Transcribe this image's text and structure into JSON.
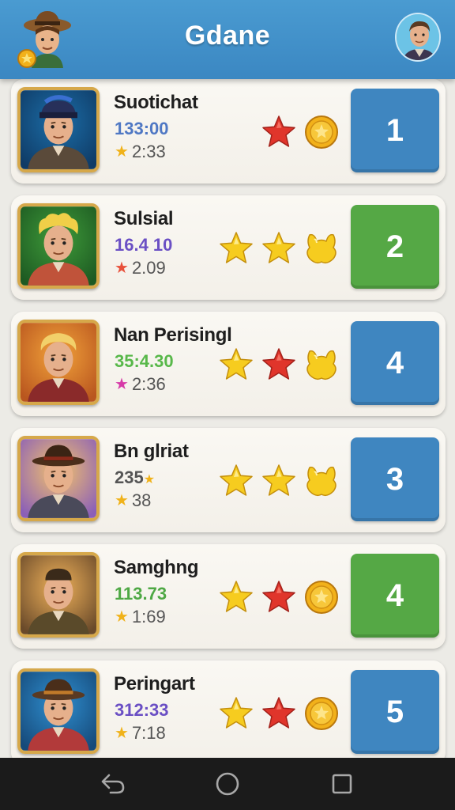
{
  "header": {
    "title": "Gdane"
  },
  "colors": {
    "header": "#3b87c2",
    "rank_blue": "#3f86c0",
    "rank_green": "#55a845",
    "star_red": "#e0352b",
    "star_yellow": "#f6cc1f",
    "coin": "#f2b11a"
  },
  "players": [
    {
      "name": "Suotichat",
      "score": "133:00",
      "score_color": "#4f78c4",
      "time": "2:33",
      "time_star_color": "#f0b21a",
      "badges": [
        "red-star-icon",
        "coin-icon"
      ],
      "rank": "1",
      "rank_color": "#3f86c0",
      "portrait_bg": [
        "#1c6ea8",
        "#0f3b66"
      ]
    },
    {
      "name": "Sulsial",
      "score": "16.4 10",
      "score_color": "#6a4fc4",
      "time": "2.09",
      "time_star_color": "#e8503a",
      "badges": [
        "yellow-star-icon",
        "yellow-star-icon",
        "yellow-cat-icon"
      ],
      "rank": "2",
      "rank_color": "#55a845",
      "portrait_bg": [
        "#3f9b3a",
        "#1d5a22"
      ]
    },
    {
      "name": "Nan Perisingl",
      "score": "35:4.30",
      "score_color": "#58b84a",
      "time": "2:36",
      "time_star_color": "#d63aa8",
      "badges": [
        "yellow-star-icon",
        "red-star-icon",
        "yellow-cat-icon"
      ],
      "rank": "4",
      "rank_color": "#3f86c0",
      "portrait_bg": [
        "#f2a33a",
        "#b9561f"
      ]
    },
    {
      "name": "Bn glriat",
      "score": "235",
      "score_color": "#555555",
      "score_star": "★",
      "time": "38",
      "time_star_color": "#f0b21a",
      "badges": [
        "yellow-star-icon",
        "yellow-star-icon",
        "yellow-cat-icon"
      ],
      "rank": "3",
      "rank_color": "#3f86c0",
      "portrait_bg": [
        "#f4c46a",
        "#8b5fb8"
      ]
    },
    {
      "name": "Samghng",
      "score": "113.73",
      "score_color": "#4ea844",
      "time": "1:69",
      "time_star_color": "#f0b21a",
      "badges": [
        "yellow-star-icon",
        "red-star-icon",
        "coin-icon"
      ],
      "rank": "4",
      "rank_color": "#55a845",
      "portrait_bg": [
        "#f0b25a",
        "#6a4a2a"
      ]
    },
    {
      "name": "Peringart",
      "score": "312:33",
      "score_color": "#6a4fc4",
      "time": "7:18",
      "time_star_color": "#f0b21a",
      "badges": [
        "yellow-star-icon",
        "red-star-icon",
        "coin-icon"
      ],
      "rank": "5",
      "rank_color": "#3f86c0",
      "portrait_bg": [
        "#2f8fd0",
        "#164a7a"
      ]
    }
  ],
  "navbar": {
    "buttons": [
      "back-icon",
      "home-icon",
      "recents-icon"
    ]
  }
}
